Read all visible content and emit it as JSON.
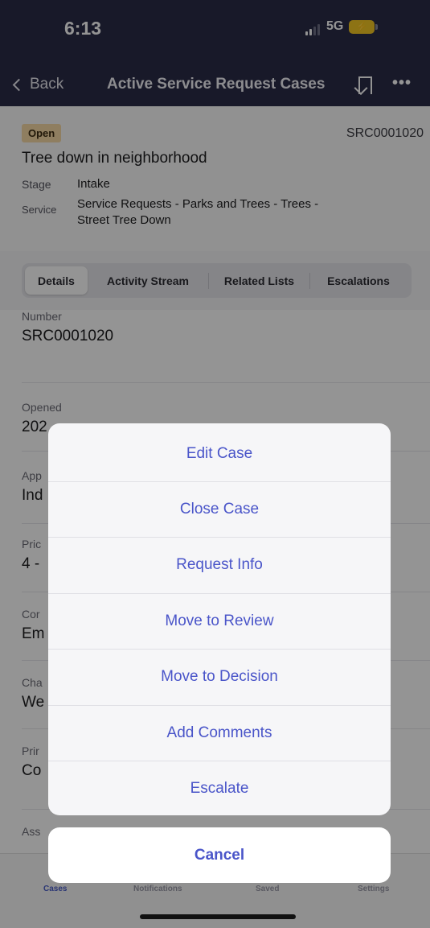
{
  "status_bar": {
    "time": "6:13",
    "network": "5G"
  },
  "nav": {
    "back_label": "Back",
    "title": "Active Service Request Cases"
  },
  "case": {
    "status": "Open",
    "number": "SRC0001020",
    "title": "Tree down in neighborhood",
    "stage_label": "Stage",
    "stage_value": "Intake",
    "service_label": "Service",
    "service_value_line1": "Service Requests - Parks and Trees - Trees -",
    "service_value_line2": "Street Tree Down"
  },
  "tabs": [
    "Details",
    "Activity Stream",
    "Related Lists",
    "Escalations"
  ],
  "details": {
    "number_label": "Number",
    "number_value": "SRC0001020",
    "opened_label": "Opened",
    "opened_value": "202",
    "app_label": "App",
    "app_value": "Ind",
    "priority_label": "Pric",
    "priority_value": "4 -",
    "contact_label": "Cor",
    "contact_value": "Em",
    "channel_label": "Cha",
    "channel_value": "We",
    "primary_label": "Prir",
    "primary_value": "Co",
    "assigned_label": "Ass"
  },
  "actions": [
    "Edit Case",
    "Close Case",
    "Request Info",
    "Move to Review",
    "Move to Decision",
    "Add Comments",
    "Escalate"
  ],
  "cancel_label": "Cancel",
  "tab_bar": [
    "Cases",
    "Notifications",
    "Saved",
    "Settings"
  ],
  "colors": {
    "header_bg": "#2a2b48",
    "accent": "#4a55c9",
    "badge_bg": "#f7d9a5"
  }
}
